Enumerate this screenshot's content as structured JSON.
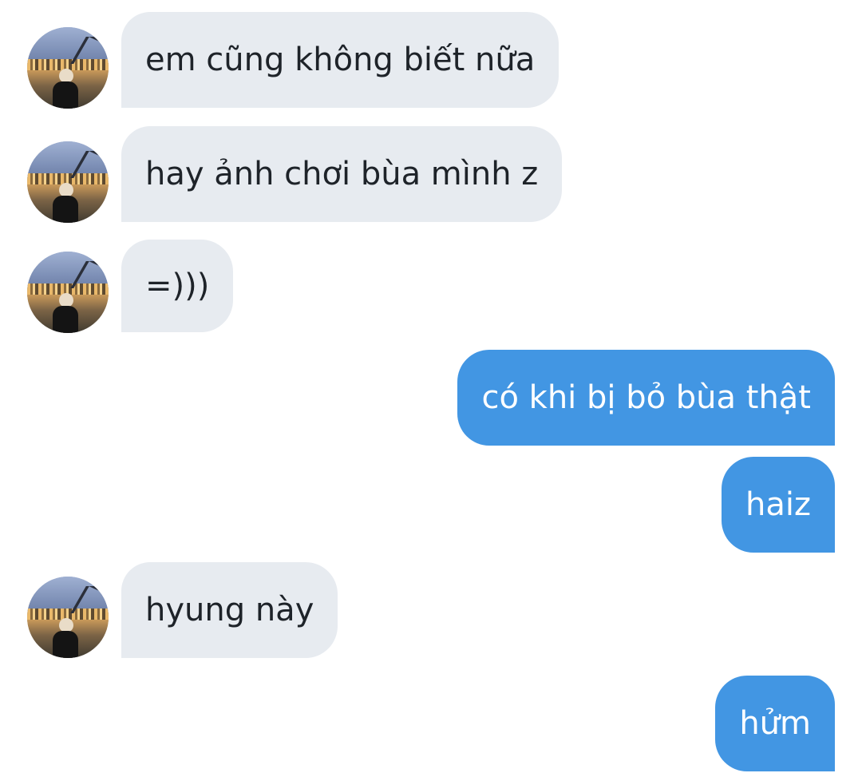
{
  "messages": [
    {
      "direction": "incoming",
      "text": "em cũng không biết nữa"
    },
    {
      "direction": "incoming",
      "text": "hay ảnh chơi bùa mình z"
    },
    {
      "direction": "incoming",
      "text": "=)))"
    },
    {
      "direction": "outgoing",
      "text": "có khi bị bỏ bùa thật"
    },
    {
      "direction": "outgoing",
      "text": "haiz"
    },
    {
      "direction": "incoming",
      "text": "hyung này"
    },
    {
      "direction": "outgoing",
      "text": "hửm"
    }
  ],
  "colors": {
    "incoming_bubble": "#e7ebf0",
    "incoming_text": "#1e2329",
    "outgoing_bubble": "#4296e3",
    "outgoing_text": "#ffffff",
    "background": "#ffffff"
  },
  "icons": {
    "avatar": "contact-avatar-photo"
  }
}
